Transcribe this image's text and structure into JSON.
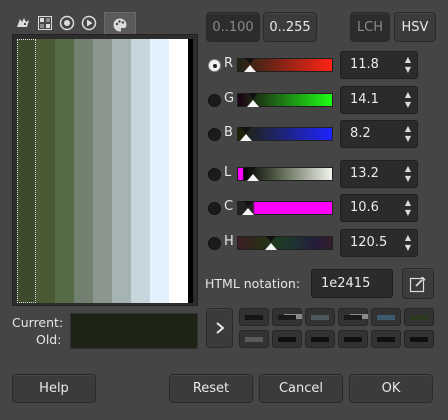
{
  "tabs": [
    {
      "name": "gimp-wilber-icon"
    },
    {
      "name": "cmyk-grid-icon"
    },
    {
      "name": "watercolor-circle-icon"
    },
    {
      "name": "triangle-wheel-icon"
    },
    {
      "name": "palette-icon",
      "active": true
    }
  ],
  "palette": {
    "swatches": [
      "#3d4a2c",
      "#4a5a34",
      "#566c46",
      "#728070",
      "#8a968e",
      "#a6b3b4",
      "#c7d6dc",
      "#e2f1fb",
      "#ffffff"
    ]
  },
  "range_buttons": {
    "r100": "0..100",
    "r255": "0..255"
  },
  "mode_buttons": {
    "lch": "LCH",
    "hsv": "HSV"
  },
  "channels": [
    {
      "label": "R",
      "value": "11.8",
      "checked": true,
      "marker": 0.118
    },
    {
      "label": "G",
      "value": "14.1",
      "checked": false,
      "marker": 0.141
    },
    {
      "label": "B",
      "value": "8.2",
      "checked": false,
      "marker": 0.082
    },
    {
      "label": "L",
      "value": "13.2",
      "checked": false,
      "marker": 0.132
    },
    {
      "label": "C",
      "value": "10.6",
      "checked": false,
      "marker": 0.106
    },
    {
      "label": "H",
      "value": "120.5",
      "checked": false,
      "marker": 0.335
    }
  ],
  "html_notation": {
    "label": "HTML notation:",
    "value": "1e2415"
  },
  "current_label": "Current:",
  "old_label": "Old:",
  "current_color": "#1e2415",
  "history": [
    "#141414",
    "#1a1a1a",
    "#2f3a3b",
    "#202020",
    "#3e5a6e",
    "#2b3a1e",
    "#5a5a5a",
    "#101010",
    "#101010",
    "#101010",
    "#101010",
    "#101010"
  ],
  "buttons": {
    "help": "Help",
    "reset": "Reset",
    "cancel": "Cancel",
    "ok": "OK"
  }
}
